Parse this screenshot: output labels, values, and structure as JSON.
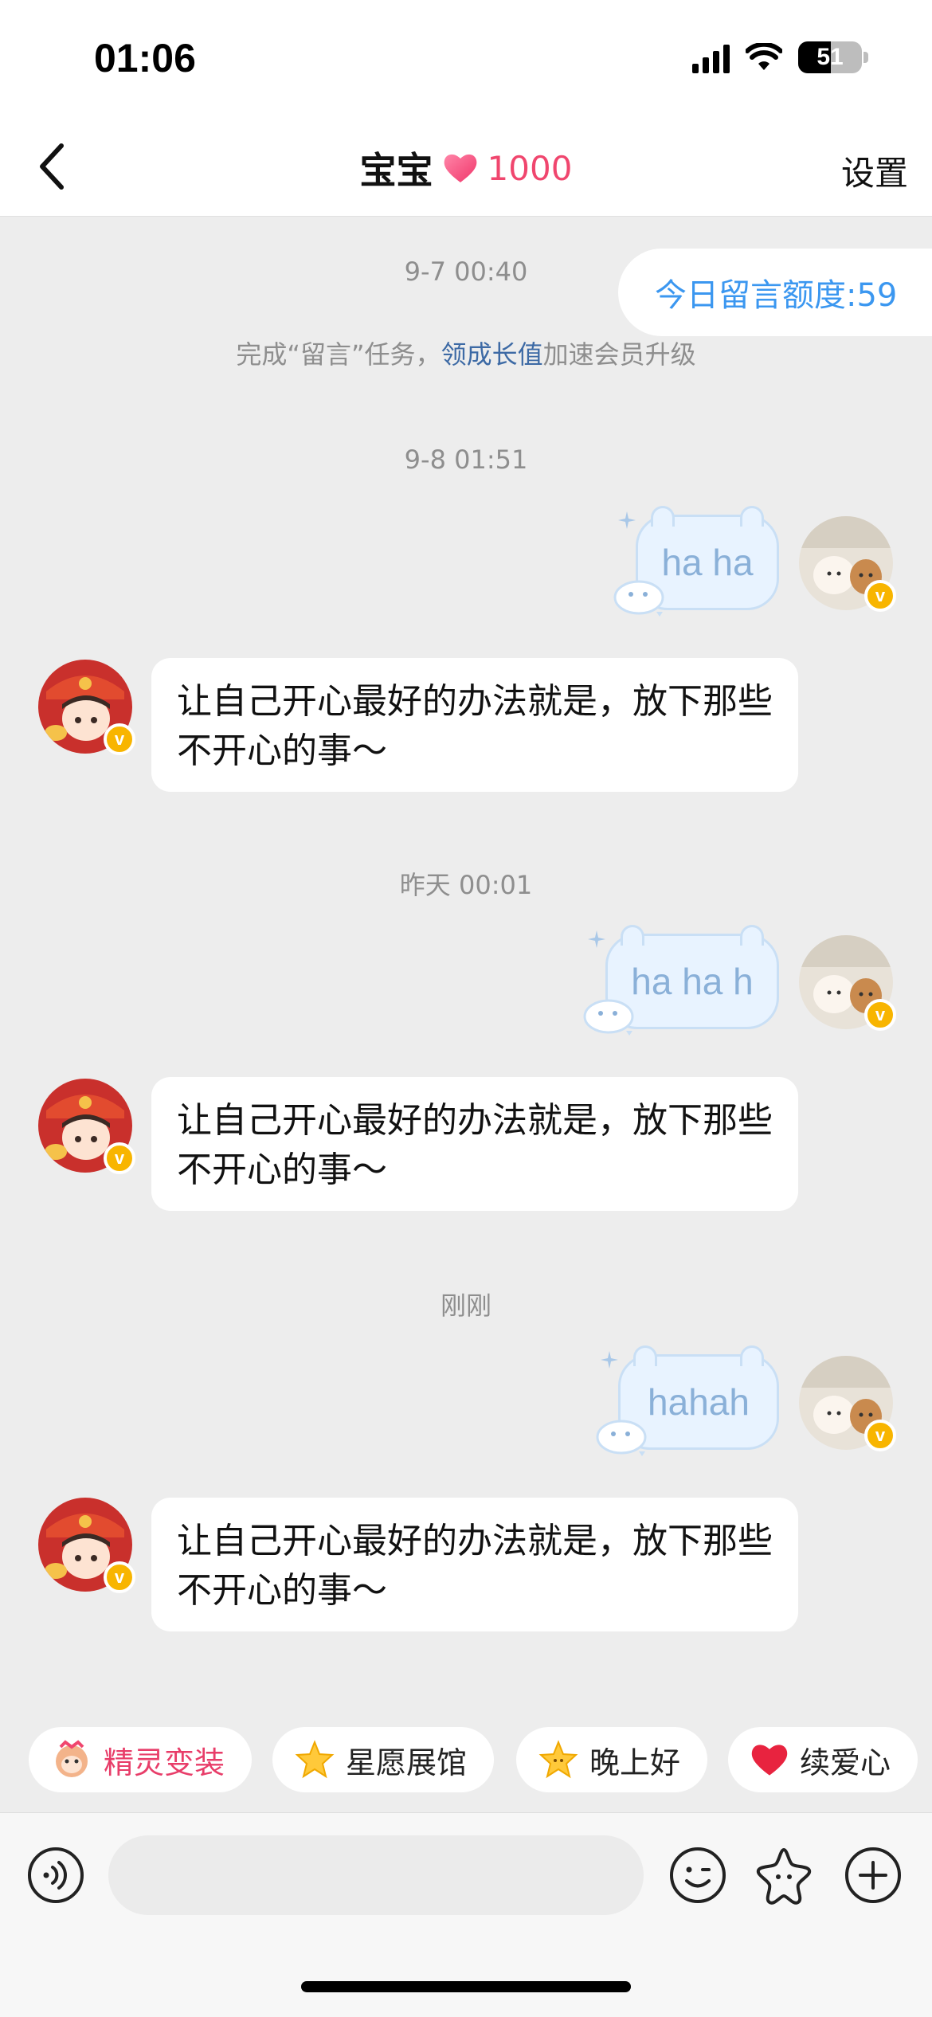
{
  "status_bar": {
    "time": "01:06",
    "battery": "51"
  },
  "header": {
    "title": "宝宝",
    "heart_count": "1000",
    "settings_label": "设置"
  },
  "quota": {
    "label": "今日留言额度:59"
  },
  "messages": [
    {
      "timestamp": "9-7 00:40"
    },
    {
      "system_prefix": "完成“留言”任务，",
      "system_link": "领成长值",
      "system_suffix": "加速会员升级"
    },
    {
      "timestamp": "9-8 01:51"
    },
    {
      "sent": "ha ha"
    },
    {
      "received": "让自己开心最好的办法就是，放下那些不开心的事～"
    },
    {
      "timestamp": "昨天 00:01"
    },
    {
      "sent": "ha ha h"
    },
    {
      "received": "让自己开心最好的办法就是，放下那些不开心的事～"
    },
    {
      "timestamp": "刚刚"
    },
    {
      "sent": "hahah"
    },
    {
      "received": "让自己开心最好的办法就是，放下那些不开心的事～"
    }
  ],
  "quick_actions": [
    {
      "label": "精灵变装",
      "icon": "monkey-icon"
    },
    {
      "label": "星愿展馆",
      "icon": "star-icon"
    },
    {
      "label": "晚上好",
      "icon": "star-face-icon"
    },
    {
      "label": "续爱心",
      "icon": "heart-icon"
    }
  ],
  "input": {
    "value": "",
    "placeholder": ""
  },
  "colors": {
    "accent_pink": "#f0466e",
    "quota_blue": "#3b97f0",
    "link_blue": "#3d6aa5",
    "badge_gold": "#f8b500",
    "my_bubble_bg": "#e8f3ff"
  }
}
